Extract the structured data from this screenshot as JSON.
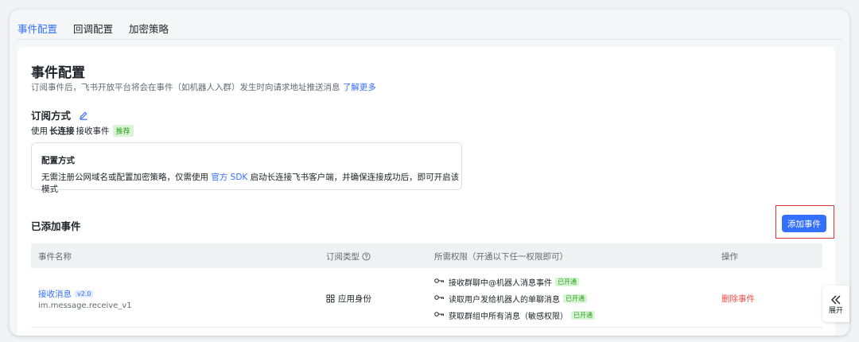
{
  "tabs": [
    {
      "label": "事件配置",
      "active": true
    },
    {
      "label": "回调配置",
      "active": false
    },
    {
      "label": "加密策略",
      "active": false
    }
  ],
  "header": {
    "title": "事件配置",
    "description": "订阅事件后，飞书开放平台将会在事件（如机器人入群）发生时向请求地址推送消息",
    "learn_more": "了解更多"
  },
  "subscription": {
    "title": "订阅方式",
    "use_prefix": "使用",
    "use_method": "长连接",
    "use_suffix": "接收事件",
    "recommended_tag": "推荐",
    "config_box": {
      "title": "配置方式",
      "text_before": "无需注册公网域名或配置加密策略，仅需使用",
      "sdk_link": "官方 SDK",
      "text_after": "启动长连接飞书客户端，并确保连接成功后，即可开启该模式"
    }
  },
  "added_events": {
    "title": "已添加事件",
    "add_button": "添加事件",
    "columns": [
      "事件名称",
      "订阅类型",
      "所需权限（开通以下任一权限即可）",
      "操作"
    ],
    "rows": [
      {
        "name": "接收消息",
        "version": "v2.0",
        "key": "im.message.receive_v1",
        "subscription_type": "应用身份",
        "permissions": [
          {
            "label": "接收群聊中@机器人消息事件",
            "status": "已开通"
          },
          {
            "label": "读取用户发给机器人的单聊消息",
            "status": "已开通"
          },
          {
            "label": "获取群组中所有消息（敏感权限）",
            "status": "已开通"
          }
        ],
        "action": "删除事件"
      }
    ]
  },
  "expand_panel": {
    "label": "展开"
  },
  "colors": {
    "primary": "#3370ff",
    "danger": "#f54a45",
    "success": "#2ea121",
    "highlight_border": "#e03131"
  }
}
